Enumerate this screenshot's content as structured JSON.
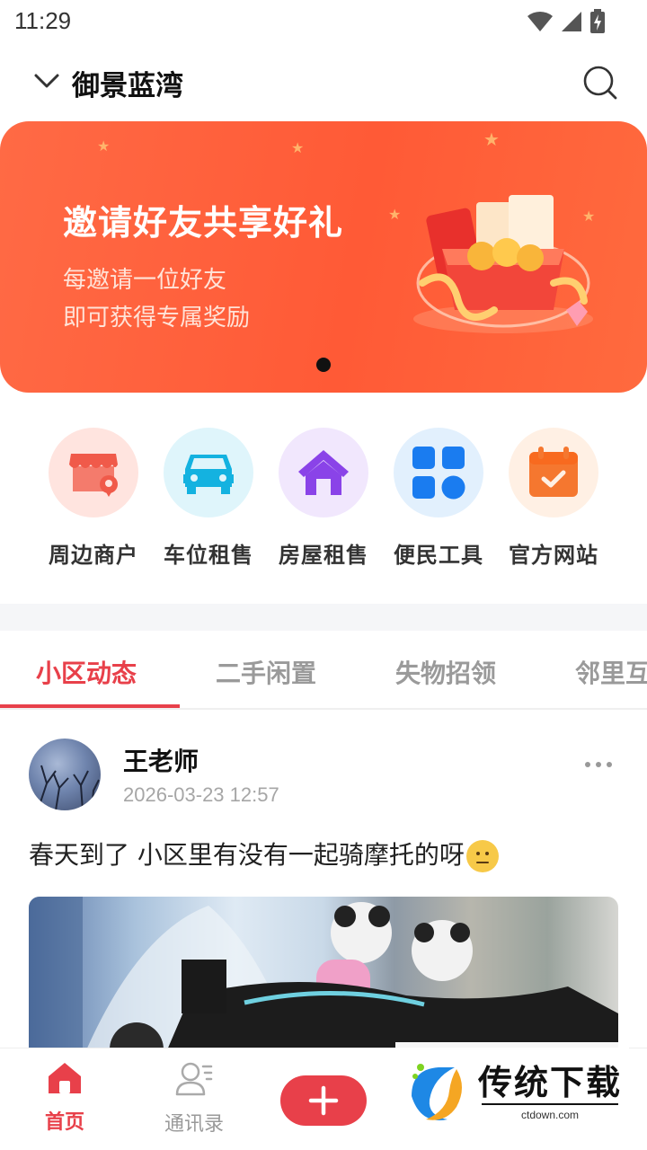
{
  "status_bar": {
    "time": "11:29"
  },
  "header": {
    "title": "御景蓝湾"
  },
  "banner": {
    "title": "邀请好友共享好礼",
    "subtitle_line1": "每邀请一位好友",
    "subtitle_line2": "即可获得专属奖励",
    "page_count": 1,
    "active_page": 1
  },
  "quick_actions": [
    {
      "label": "周边商户",
      "icon": "store-icon",
      "color": "#f05a4a",
      "bg": "#ffe4df"
    },
    {
      "label": "车位租售",
      "icon": "car-icon",
      "color": "#14b2e0",
      "bg": "#dff5fb"
    },
    {
      "label": "房屋租售",
      "icon": "house-icon",
      "color": "#8a43e8",
      "bg": "#f1e7fd"
    },
    {
      "label": "便民工具",
      "icon": "grid-icon",
      "color": "#1a7cf0",
      "bg": "#e2f0fd"
    },
    {
      "label": "官方网站",
      "icon": "calendar-icon",
      "color": "#f5772f",
      "bg": "#fff0e4"
    }
  ],
  "tabs": [
    {
      "label": "小区动态",
      "active": true
    },
    {
      "label": "二手闲置",
      "active": false
    },
    {
      "label": "失物招领",
      "active": false
    },
    {
      "label": "邻里互",
      "active": false
    }
  ],
  "post": {
    "author": "王老师",
    "time": "2026-03-23 12:57",
    "text": "春天到了 小区里有没有一起骑摩托的呀"
  },
  "bottom_nav": {
    "home_label": "首页",
    "contacts_label": "通讯录"
  },
  "watermark": {
    "brand": "传统下载",
    "url": "ctdown.com"
  },
  "colors": {
    "accent": "#e8404a",
    "banner": "#ff5a36"
  }
}
